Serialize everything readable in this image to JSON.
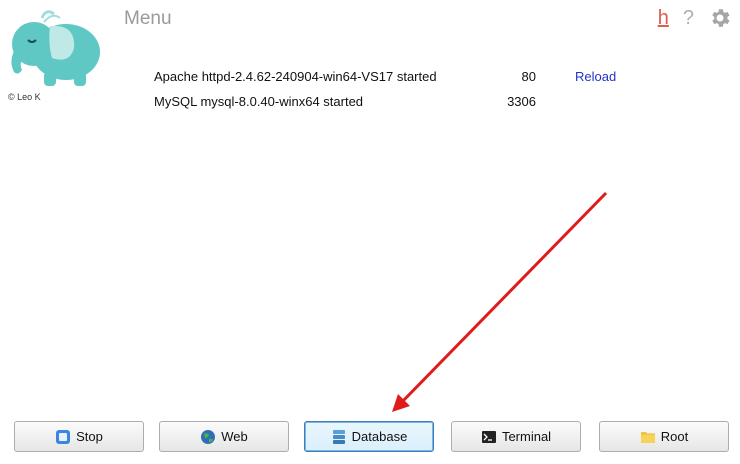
{
  "header": {
    "title": "Menu",
    "copyright": "© Leo K",
    "help_letter": "h",
    "help_question": "?"
  },
  "services": [
    {
      "name": "Apache httpd-2.4.62-240904-win64-VS17 started",
      "port": "80",
      "action": "Reload"
    },
    {
      "name": "MySQL mysql-8.0.40-winx64 started",
      "port": "3306",
      "action": ""
    }
  ],
  "buttons": {
    "stop": "Stop",
    "web": "Web",
    "database": "Database",
    "terminal": "Terminal",
    "root": "Root"
  },
  "colors": {
    "accent_link": "#2233cc",
    "help_h": "#e25a4a",
    "annotation_arrow": "#e01b1b",
    "logo_teal": "#5fc7c4"
  },
  "icons": {
    "logo": "elephant-logo-icon",
    "settings": "gear-icon",
    "stop": "stop-square-icon",
    "web": "globe-icon",
    "database": "database-icon",
    "terminal": "terminal-icon",
    "root": "folder-icon"
  }
}
